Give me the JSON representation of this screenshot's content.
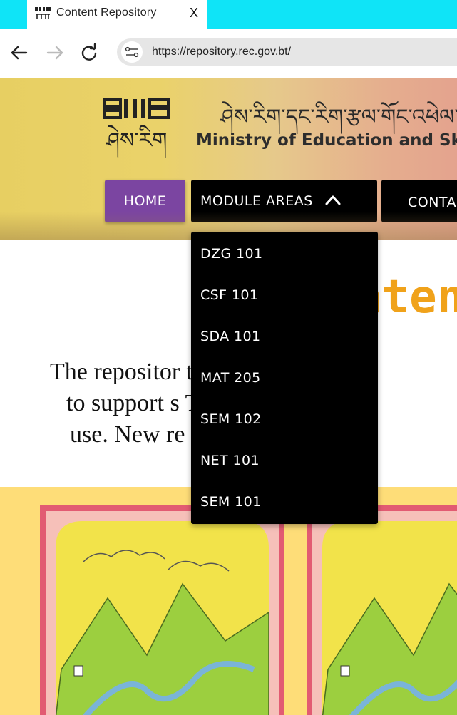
{
  "browser": {
    "tab_title": "Content Repository",
    "tab_close": "X",
    "url": "https://repository.rec.gov.bt/",
    "icons": {
      "back": "arrow-left-icon",
      "forward": "arrow-right-icon",
      "reload": "reload-icon",
      "site_info": "site-settings-icon",
      "favicon": "dzongkha-logo-icon"
    }
  },
  "header": {
    "tibetan_title": "ཤེས་རིག་དང་རིག་རྩལ་གོང་འཕེལ་",
    "ministry_title": "Ministry of Education and Skills De",
    "logo_glyph": "ཤེས་རིག"
  },
  "nav": {
    "home": "HOME",
    "modules": "MODULE AREAS",
    "contact": "CONTA"
  },
  "dropdown": {
    "items": [
      "DZG 101",
      "CSF 101",
      "SDA 101",
      "MAT 205",
      "SEM 102",
      "NET 101",
      "SEM 101"
    ]
  },
  "main": {
    "heading_visible": "aten",
    "intro_lines": [
      "The repositor                    tions of",
      "to support s                       The reso",
      "use. New re                    added to"
    ]
  },
  "colors": {
    "tab_strip": "#0fe4f7",
    "home_button": "#7b45a1",
    "dropdown_bg": "#000000",
    "heading": "#f0a21a",
    "cards_bg": "#fedd78"
  }
}
